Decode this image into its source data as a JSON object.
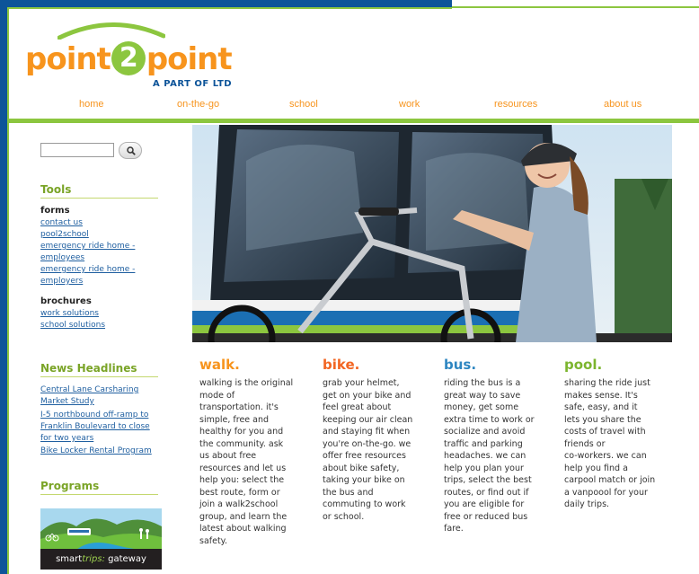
{
  "brand": {
    "name_part1": "point",
    "name_two": "2",
    "name_part2": "point",
    "tagline": "A PART OF LTD"
  },
  "nav": [
    {
      "label": "home"
    },
    {
      "label": "on-the-go"
    },
    {
      "label": "school"
    },
    {
      "label": "work"
    },
    {
      "label": "resources"
    },
    {
      "label": "about us"
    }
  ],
  "search": {
    "placeholder": ""
  },
  "sidebar": {
    "tools": {
      "heading": "Tools",
      "forms_heading": "forms",
      "forms_links": [
        "contact us",
        "pool2school",
        "emergency ride home -",
        "employees",
        "emergency ride home -",
        "employers"
      ],
      "brochures_heading": "brochures",
      "brochures_links": [
        "work solutions",
        "school solutions"
      ]
    },
    "news": {
      "heading": "News Headlines",
      "items": [
        [
          "Central Lane Carsharing",
          "Market Study"
        ],
        [
          "I-5 northbound off-ramp to",
          "Franklin Boulevard to close",
          "for two years"
        ],
        [
          "Bike Locker Rental Program"
        ]
      ]
    },
    "programs": {
      "heading": "Programs",
      "banner_part1": "smart",
      "banner_part2": "trips:",
      "banner_part3": " gateway"
    }
  },
  "colors": {
    "orange": "#f7941d",
    "green": "#8cc63f",
    "blue": "#0d5499",
    "link": "#1f5fa0"
  },
  "columns": [
    {
      "title": "walk.",
      "color": "#f7941d",
      "lines": [
        "walking is the original",
        "mode of",
        "transportation. it's",
        "simple, free and",
        "healthy for you and",
        "the community. ask",
        "us about free",
        "resources and let us",
        "help you: select the",
        "best route, form or",
        "join a walk2school",
        "group, and learn the",
        "latest about walking",
        "safety."
      ]
    },
    {
      "title": "bike.",
      "color": "#f26522",
      "lines": [
        "grab your helmet,",
        "get on your bike and",
        "feel great about",
        "keeping our air clean",
        "and staying fit when",
        "you're on-the-go. we",
        "offer free resources",
        "about  bike safety,",
        "taking your bike on",
        "the bus and",
        "commuting to work",
        "or school."
      ]
    },
    {
      "title": "bus.",
      "color": "#2e86c1",
      "lines": [
        "riding the bus is a",
        "great way to save",
        "money, get some",
        "extra time to work or",
        "socialize and avoid",
        "traffic and parking",
        "headaches. we can",
        "help you plan your",
        "trips, select the best",
        "routes, or find out if",
        "you are eligible for",
        "free or reduced bus",
        "fare."
      ]
    },
    {
      "title": "pool.",
      "color": "#7cb52e",
      "lines": [
        "sharing the ride just",
        "makes sense. It's",
        "safe, easy, and it",
        "lets you share the",
        "costs of travel with",
        "friends or",
        "co-workers. we can",
        "help you find a",
        "carpool match or join",
        "a vanpoool for your",
        "daily trips."
      ]
    }
  ]
}
